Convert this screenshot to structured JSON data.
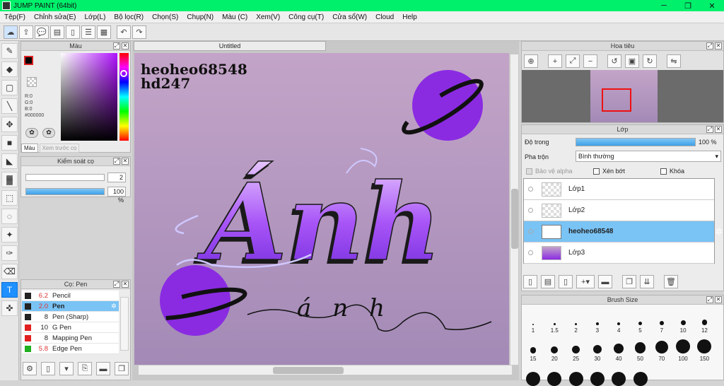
{
  "app": {
    "title": "JUMP PAINT (64bit)",
    "window_buttons": [
      "─",
      "❐",
      "✕"
    ]
  },
  "menu": [
    "Tệp(F)",
    "Chỉnh sửa(E)",
    "Lớp(L)",
    "Bộ lọc(R)",
    "Chọn(S)",
    "Chụp(N)",
    "Màu (C)",
    "Xem(V)",
    "Công cụ(T)",
    "Cửa sổ(W)",
    "Cloud",
    "Help"
  ],
  "color_panel": {
    "title": "Màu",
    "r": "R:0",
    "g": "G:0",
    "b": "B:0",
    "hex": "#000000",
    "tabs": [
      "Màu",
      "Xem trước cọ"
    ]
  },
  "brush_control": {
    "title": "Kiểm soát cọ",
    "size": "2",
    "opacity": "100 %",
    "opacity_fraction": 1.0
  },
  "brush_list": {
    "title": "Cọ: Pen",
    "items": [
      {
        "size": "6.2",
        "name": "Pencil",
        "color": "#222222"
      },
      {
        "size": "2.0",
        "name": "Pen",
        "color": "#222222",
        "selected": true
      },
      {
        "size": "8",
        "name": "Pen (Sharp)",
        "color": "#222222"
      },
      {
        "size": "10",
        "name": "G Pen",
        "color": "#e02020"
      },
      {
        "size": "8",
        "name": "Mapping Pen",
        "color": "#e02020"
      },
      {
        "size": "5.8",
        "name": "Edge Pen",
        "color": "#20b020"
      }
    ]
  },
  "canvas": {
    "tab": "Untitled",
    "watermark_line1": "heoheo68548",
    "watermark_line2": "hd247",
    "art_title": "Ánh",
    "art_sub": "ánh"
  },
  "navigator": {
    "title": "Hoa tiêu"
  },
  "layers": {
    "title": "Lớp",
    "opacity_label": "Độ trong",
    "opacity_value": "100 %",
    "opacity_fraction": 1.0,
    "blend_label": "Pha trộn",
    "blend_value": "Bình thường",
    "protect_alpha": "Bảo vệ alpha",
    "clip": "Xén bớt",
    "lock": "Khóa",
    "items": [
      {
        "name": "Lớp1",
        "selected": false
      },
      {
        "name": "Lớp2",
        "selected": false
      },
      {
        "name": "heoheo68548",
        "selected": true
      },
      {
        "name": "Lớp3",
        "selected": false
      }
    ]
  },
  "brush_size": {
    "title": "Brush Size",
    "row1": [
      "1",
      "1.5",
      "2",
      "3",
      "4",
      "5",
      "7",
      "10",
      "12"
    ],
    "row2": [
      "15",
      "20",
      "25",
      "30",
      "40",
      "50",
      "70",
      "100",
      "150"
    ]
  },
  "colors": {
    "planet": "#8a2be2",
    "accent": "#1e90ff",
    "title_bar": "#00f06c"
  }
}
